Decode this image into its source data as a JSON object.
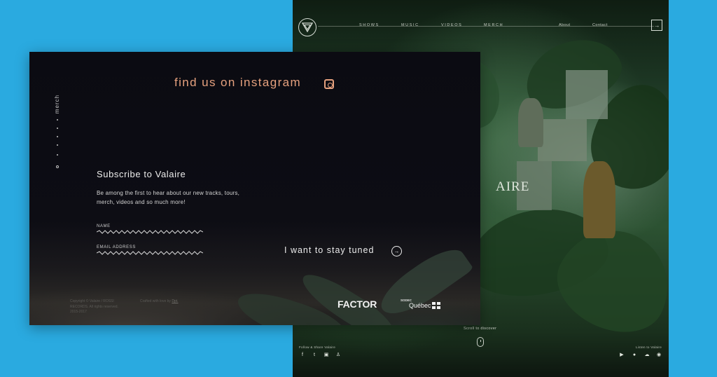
{
  "back_page": {
    "nav": [
      "SHOWS",
      "MUSIC",
      "VIDEOS",
      "MERCH"
    ],
    "secondary_nav": [
      "About",
      "Contact"
    ],
    "enter_icon": "arrow-right-box-icon",
    "band_name_partial": "AIRE",
    "scroll_text": "Scroll to discover",
    "follow_label": "Follow & Share Valaire",
    "listen_label": "Listen to Valaire",
    "follow_icons": [
      "facebook-icon",
      "twitter-icon",
      "instagram-icon",
      "snapchat-icon"
    ],
    "listen_icons": [
      "youtube-icon",
      "apple-icon",
      "soundcloud-icon",
      "spotify-icon"
    ]
  },
  "front_page": {
    "vertical_nav_label": "merch",
    "instagram_title": "find us on instagram",
    "subscribe_title": "Subscribe to Valaire",
    "subscribe_desc": "Be among the first to hear about our new tracks, tours, merch, videos and so much more!",
    "name_label": "NAME",
    "email_label": "EMAIL ADDRESS",
    "cta": "I want to stay tuned",
    "copyright": "Copyright © Valaire / ROSSI RECORDS. All rights reserved. 2015-2017",
    "crafted_prefix": "Crafted with love by",
    "crafted_link": "Dpt.",
    "factor_logo": "FACTOR",
    "sodec_logo": "SODEC",
    "quebec_logo": "Québec"
  },
  "colors": {
    "background": "#2aaae0",
    "accent": "#e6a17e",
    "dark": "#0b0b12",
    "green": "#2c5232"
  }
}
